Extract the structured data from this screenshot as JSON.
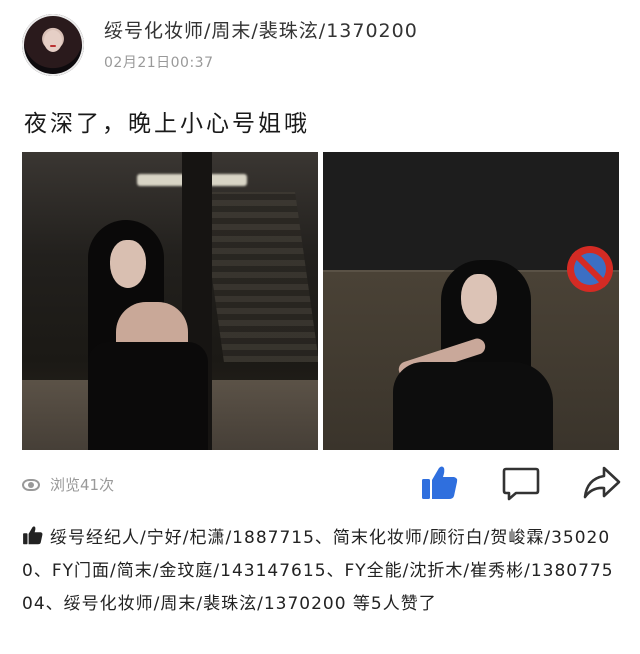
{
  "post": {
    "username": "绥号化妆师/周末/裴珠泫/1370200",
    "timestamp": "02月21日00:37",
    "text": "夜深了，晚上小心号姐哦"
  },
  "stats": {
    "views": "浏览41次"
  },
  "likes": {
    "text": "绥号经纪人/宁好/杞潇/1887715、简末化妆师/顾衍白/贺峻霖/350200、FY门面/简末/金玟庭/143147615、FY全能/沈折木/崔秀彬/138077504、绥号化妆师/周末/裴珠泫/1370200 等5人赞了"
  },
  "colors": {
    "accent": "#2f6fde",
    "muted": "#999999"
  },
  "icons": [
    "eye-icon",
    "thumb-up-icon",
    "comment-icon",
    "share-icon"
  ]
}
